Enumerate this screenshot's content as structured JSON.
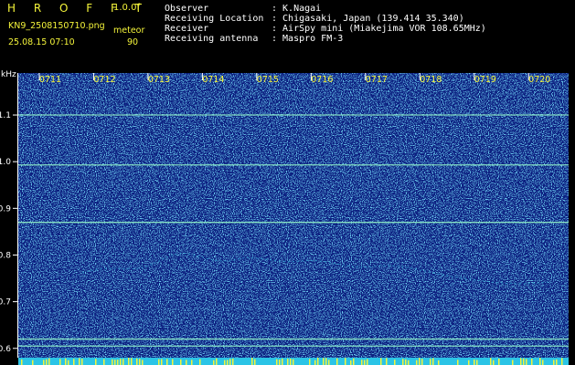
{
  "header": {
    "logo": "H R O F F T",
    "version": "1.0.0f",
    "filename": "KN9_2508150710.png",
    "datetime": "25.08.15 07:10",
    "mode": "meteor",
    "value": "90",
    "info": [
      {
        "label": "Observer",
        "value": ": K.Nagai"
      },
      {
        "label": "Receiving Location",
        "value": ": Chigasaki, Japan (139.414 35.340)"
      },
      {
        "label": "Receiver",
        "value": ": AirSpy mini (Miakejima VOR 108.65MHz)"
      },
      {
        "label": "Receiving antenna",
        "value": ": Maspro FM-3"
      }
    ]
  },
  "chart_data": {
    "type": "heatmap",
    "ylabel": "kHz",
    "y_ticks": [
      "1.1",
      "1.0",
      "0.9",
      "0.8",
      "0.7",
      "0.6"
    ],
    "y_tick_values": [
      1.1,
      1.0,
      0.9,
      0.8,
      0.7,
      0.6
    ],
    "x_ticks": [
      "0711",
      "0712",
      "0713",
      "0714",
      "0715",
      "0716",
      "0717",
      "0718",
      "0719",
      "0720"
    ],
    "ylim": [
      0.58,
      1.19
    ],
    "signal_lines_khz": [
      1.1,
      0.993,
      0.87,
      0.62,
      0.605
    ],
    "colors": {
      "background": "#0c1f80",
      "noise": "#2a9bd8",
      "line": "#8ff0c8",
      "axis": "#ffffff"
    }
  }
}
